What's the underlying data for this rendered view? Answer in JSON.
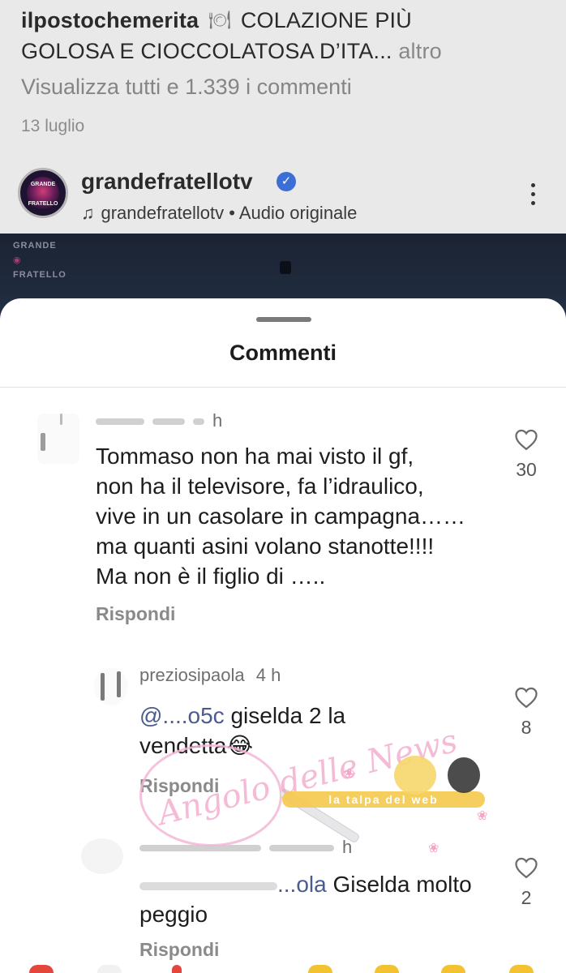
{
  "background_post": {
    "caption_user": "ilpostochemerita",
    "caption_emoji": "🍽",
    "caption_text_line1": "COLAZIONE PIÙ",
    "caption_text_line2": "GOLOSA E CIOCCOLATOSA D’ITA...",
    "caption_more": "altro",
    "view_all_comments": "Visualizza tutti e 1.339 i commenti",
    "date": "13 luglio"
  },
  "next_post": {
    "avatar_top": "GRANDE",
    "avatar_bottom": "FRATELLO",
    "account": "grandefratellotv",
    "verified_icon": "verified-badge-icon",
    "audio_text": "grandefratellotv • Audio originale",
    "video_logo_top": "GRANDE",
    "video_logo_bottom": "FRATELLO"
  },
  "sheet": {
    "title": "Commenti"
  },
  "comments": [
    {
      "meta": "h",
      "body": [
        "Tommaso non ha mai visto il gf,",
        "non ha il televisore, fa l’idraulico,",
        "vive in un casolare in campagna……",
        "ma quanti asini volano stanotte!!!!",
        "Ma non è il figlio di ….."
      ],
      "reply": "Rispondi",
      "likes": "30"
    },
    {
      "meta_user": "preziosipaola",
      "meta_time": "4 h",
      "mention": "@....o5c",
      "body_line1": " giselda 2 la",
      "body_line2": "vendetta😂",
      "reply": "Rispondi",
      "likes": "8"
    },
    {
      "meta_time": "h",
      "mention": "...ola",
      "body_line1": " Giselda molto",
      "body_line2": "peggio",
      "reply": "Rispondi",
      "likes": "2"
    }
  ],
  "watermark": {
    "script": "Angolo delle News",
    "band": "la talpa del web"
  },
  "colors": {
    "sheet_bg": "#ffffff",
    "dimmed_bg": "#e9e9e9",
    "mention": "#4a5c8e",
    "verified": "#3b6fd6"
  }
}
